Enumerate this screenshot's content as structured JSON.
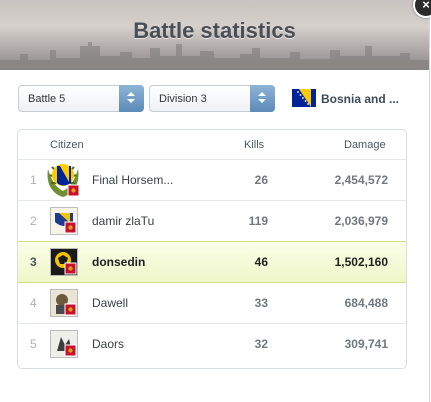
{
  "dialog": {
    "title": "Battle statistics",
    "close_label": "×"
  },
  "filters": {
    "battle": "Battle 5",
    "division": "Division 3",
    "country": "Bosnia and ..."
  },
  "table": {
    "headers": {
      "citizen": "Citizen",
      "kills": "Kills",
      "damage": "Damage"
    },
    "rows": [
      {
        "rank": "1",
        "citizen": "Final Horsem...",
        "kills": "26",
        "damage": "2,454,572",
        "highlighted": false
      },
      {
        "rank": "2",
        "citizen": "damir zlaTu",
        "kills": "119",
        "damage": "2,036,979",
        "highlighted": false
      },
      {
        "rank": "3",
        "citizen": "donsedin",
        "kills": "46",
        "damage": "1,502,160",
        "highlighted": true
      },
      {
        "rank": "4",
        "citizen": "Dawell",
        "kills": "33",
        "damage": "684,488",
        "highlighted": false
      },
      {
        "rank": "5",
        "citizen": "Daors",
        "kills": "32",
        "damage": "309,741",
        "highlighted": false
      }
    ]
  },
  "colors": {
    "accent_blue": "#5b8bb8",
    "highlight_row": "#eff7c8",
    "montenegro_red": "#c8102e",
    "bosnia_blue": "#002395",
    "bosnia_yellow": "#fecb00"
  }
}
